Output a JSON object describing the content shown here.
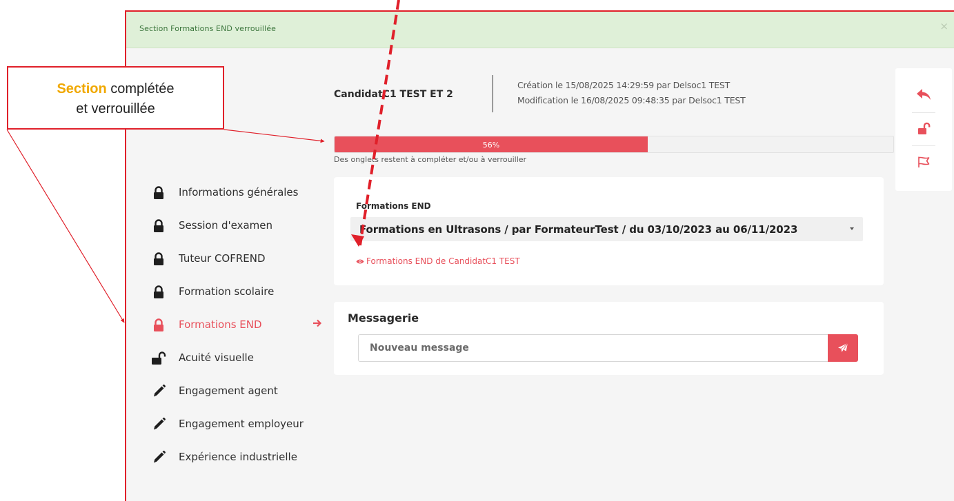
{
  "alert": {
    "text": "Section Formations END verrouillée",
    "close": "×"
  },
  "header": {
    "candidate_name": "CandidatC1 TEST ET 2",
    "created": "Création le 15/08/2025 14:29:59 par Delsoc1 TEST",
    "modified": "Modification le 16/08/2025 09:48:35 par Delsoc1 TEST"
  },
  "actions": [
    {
      "icon": "reply-icon",
      "color": "#e8505b"
    },
    {
      "icon": "unlock-icon",
      "color": "#e8505b"
    },
    {
      "icon": "flag-icon",
      "color": "#e8505b"
    }
  ],
  "progress": {
    "value": 0.56,
    "label": "56%",
    "hint": "Des onglets restent à compléter et/ou à verrouiller"
  },
  "nav": {
    "items": [
      {
        "label": "Informations générales",
        "icon": "lock-icon"
      },
      {
        "label": "Session d'examen",
        "icon": "lock-icon"
      },
      {
        "label": "Tuteur COFREND",
        "icon": "lock-icon"
      },
      {
        "label": "Formation scolaire",
        "icon": "lock-icon"
      },
      {
        "label": "Formations END",
        "icon": "lock-icon",
        "active": true
      },
      {
        "label": "Acuité visuelle",
        "icon": "unlock-icon"
      },
      {
        "label": "Engagement agent",
        "icon": "pencil-icon"
      },
      {
        "label": "Engagement employeur",
        "icon": "pencil-icon"
      },
      {
        "label": "Expérience industrielle",
        "icon": "pencil-icon"
      }
    ]
  },
  "formations": {
    "field_label": "Formations END",
    "selected": "Formations en Ultrasons / par FormateurTest / du 03/10/2023 au 06/11/2023",
    "link": "Formations END de CandidatC1 TEST"
  },
  "messagerie": {
    "title": "Messagerie",
    "placeholder": "Nouveau message"
  },
  "callout": {
    "highlight": "Section",
    "rest": " complétée",
    "line2": "et verrouillée"
  },
  "colors": {
    "accent": "#e8505b",
    "annotation": "#e0202a",
    "alert_bg": "#dff0d8",
    "alert_text": "#3c763d",
    "highlight": "#f0a800"
  }
}
